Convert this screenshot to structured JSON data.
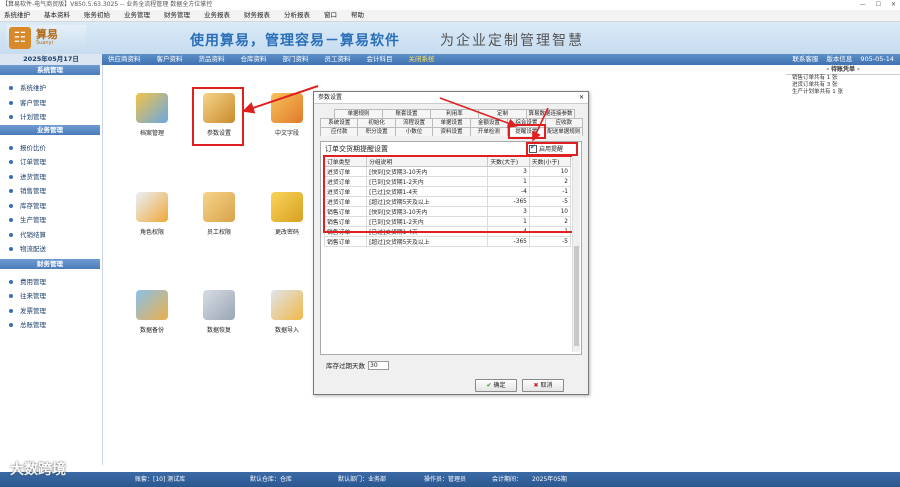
{
  "window": {
    "title": "【算易软件-电气商贸版】V850.5.63.3025 -- 业务全流程管理 数据全方位掌控",
    "controls": [
      "—",
      "☐",
      "✕"
    ]
  },
  "menu": [
    "系统维护",
    "基本资料",
    "账务初始",
    "业务管理",
    "财务管理",
    "业务报表",
    "财务报表",
    "分析报表",
    "窗口",
    "帮助"
  ],
  "banner": {
    "logo_name": "算易",
    "logo_sub": "Suanyi",
    "slogan": "使用算易，管理容易－算易软件",
    "slogan2": "为企业定制管理智慧"
  },
  "nav": {
    "date": "2025年05月17日",
    "links": [
      "供应商资料",
      "客户资料",
      "货品资料",
      "仓库资料",
      "部门资料",
      "员工资料",
      "会计科目",
      "关闭系统"
    ],
    "active_index": 7,
    "right": [
      "联系客服",
      "版本信息",
      "905-05-14"
    ]
  },
  "sidebar": [
    {
      "title": "系统管理",
      "items": [
        "系统维护",
        "客户管理",
        "计划管理"
      ]
    },
    {
      "title": "业务管理",
      "items": [
        "报价比价",
        "订单管理",
        "进货管理",
        "销售管理",
        "库存管理",
        "生产管理",
        "代销结算",
        "物流配送"
      ]
    },
    {
      "title": "财务管理",
      "items": [
        "费用管理",
        "往来管理",
        "发票管理",
        "总账管理"
      ]
    }
  ],
  "tiles": [
    "档案管理",
    "参数设置",
    "中文字段",
    "角色权限",
    "员工权限",
    "更改密码",
    "数据备份",
    "数据恢复",
    "数据导入"
  ],
  "reminders": {
    "title": "- 待账凭单 -",
    "lines": [
      "销售订单共有 1 张",
      "进货订单共有 3 张",
      "生产计划单共有 1 张"
    ]
  },
  "dialog": {
    "title": "参数设置",
    "close": "✕",
    "tabs_row1": [
      "单据规则",
      "账套设置",
      "利用率",
      "定制",
      "算易数据连接参数"
    ],
    "tabs_row2": [
      "系统设置",
      "初始化",
      "流程设置",
      "单据设置",
      "金额设置",
      "综合设置",
      "应收款"
    ],
    "tabs_row3": [
      "应付款",
      "积分设置",
      "小数位",
      "资料设置",
      "开单检测",
      "提醒设置",
      "配送单据规则"
    ],
    "panel_title": "订单交货期提醒设置",
    "enable_label": "启用提醒",
    "columns": [
      "订单类型",
      "分组说明",
      "天数(大于)",
      "天数(小于)"
    ],
    "rows": [
      [
        "进货订单",
        "[快到]交货期3-10天内",
        "3",
        "10"
      ],
      [
        "进货订单",
        "[已到]交货期1-2天内",
        "1",
        "2"
      ],
      [
        "进货订单",
        "[已过]交货期1-4天",
        "-4",
        "-1"
      ],
      [
        "进货订单",
        "[超过]交货期5天及以上",
        "-365",
        "-5"
      ],
      [
        "销售订单",
        "[快到]交货期3-10天内",
        "3",
        "10"
      ],
      [
        "销售订单",
        "[已到]交货期1-2天内",
        "1",
        "2"
      ],
      [
        "销售订单",
        "[已过]交货期1-4天",
        "-4",
        "-1"
      ],
      [
        "销售订单",
        "[超过]交货期5天及以上",
        "-365",
        "-5"
      ]
    ],
    "stock_label": "库存过期天数",
    "stock_value": "30",
    "ok": "确定",
    "cancel": "取消"
  },
  "status": {
    "operator": "账套：[10] 测试库",
    "warehouse": "默认仓库：仓库",
    "department": "默认部门：业务部",
    "user": "操作员：管理员",
    "period": "会计期间：",
    "period_value": "2025年05期"
  },
  "watermark": "大数跨境",
  "colors": {
    "highlight": "#e02020",
    "nav": "#3f72b0",
    "accent_yellow": "#ffe25a"
  }
}
